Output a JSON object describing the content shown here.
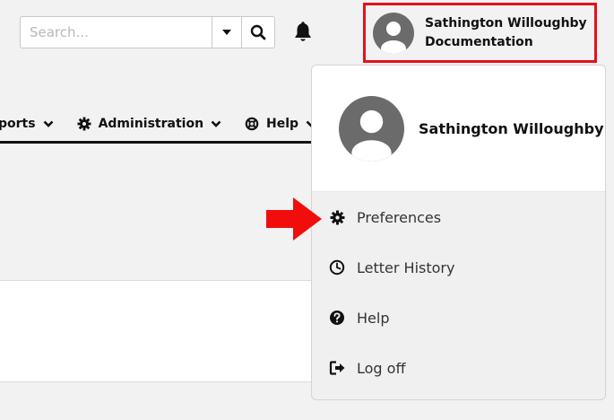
{
  "search": {
    "placeholder": "Search..."
  },
  "user": {
    "name": "Sathington Willoughby",
    "subtitle": "Documentation"
  },
  "nav": {
    "items": [
      {
        "label": "ports"
      },
      {
        "label": "Administration"
      },
      {
        "label": "Help"
      }
    ]
  },
  "dropdown": {
    "name": "Sathington Willoughby",
    "items": [
      {
        "label": "Preferences",
        "icon": "gear-icon"
      },
      {
        "label": "Letter History",
        "icon": "clock-icon"
      },
      {
        "label": "Help",
        "icon": "question-circle-icon"
      },
      {
        "label": "Log off",
        "icon": "sign-out-icon"
      }
    ]
  },
  "colors": {
    "highlight": "#e5101c",
    "avatar": "#6b6b6b",
    "menu_bg": "#f0f0f0"
  }
}
